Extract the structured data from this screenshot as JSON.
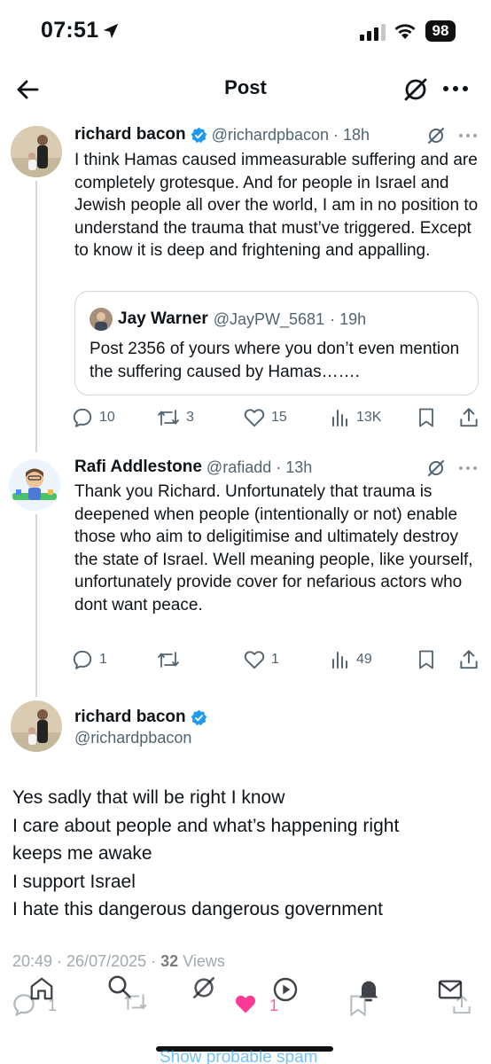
{
  "status_bar": {
    "time": "07:51",
    "battery": "98"
  },
  "header": {
    "title": "Post"
  },
  "tweet1": {
    "name": "richard bacon",
    "handle": "@richardpbacon",
    "time": "· 18h",
    "text": "I think Hamas caused immeasurable suffering and are completely grotesque. And for people in Israel and Jewish people all over the world, I am in no position to understand the trauma that must’ve triggered. Except to know it is deep and frightening and appalling.",
    "quote": {
      "name": "Jay Warner",
      "handle": "@JayPW_5681",
      "time": "· 19h",
      "text": "Post 2356 of yours where you don’t even mention the suffering caused by Hamas……."
    },
    "replies": "10",
    "reposts": "3",
    "likes": "15",
    "views": "13K"
  },
  "tweet2": {
    "name": "Rafi Addlestone",
    "handle": "@rafiadd",
    "time": "· 13h",
    "text": "Thank you Richard. Unfortunately that trauma is deepened when people (intentionally or not) enable those who aim to deligitimise and ultimately destroy the state of Israel. Well meaning people, like yourself, unfortunately provide cover for nefarious actors who dont want peace.",
    "replies": "1",
    "reposts": "",
    "likes": "1",
    "views": "49"
  },
  "main_tweet": {
    "name": "richard bacon",
    "handle": "@richardpbacon",
    "lines": [
      "Yes sadly that will be right I know",
      "I care about people and what’s happening right",
      "keeps me awake",
      "I support Israel",
      "I hate this dangerous dangerous government"
    ],
    "timestamp": "20:49 · 26/07/2025 ·",
    "views_count": "32",
    "views_label": "Views"
  },
  "bottom": {
    "reply_count": "1",
    "like_count": "1",
    "spam_link": "Show probable spam"
  },
  "colors": {
    "verified_blue": "#1d9bf0",
    "secondary_text": "#536471",
    "like_pink": "#f91880"
  }
}
